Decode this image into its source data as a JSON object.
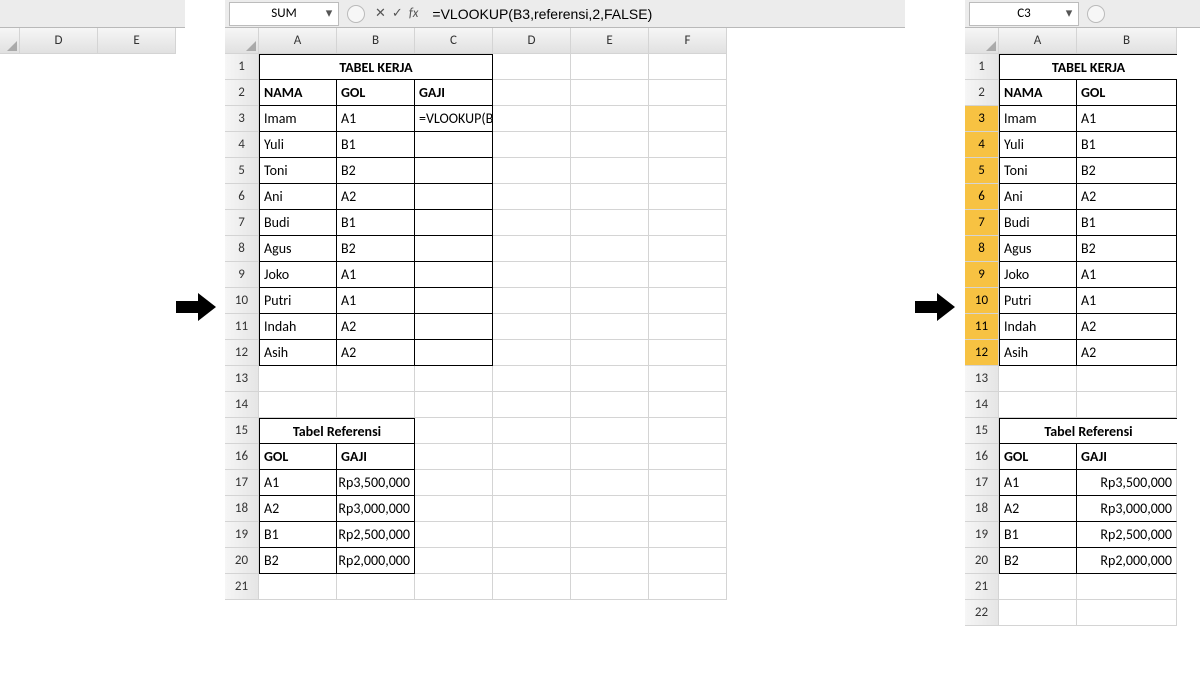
{
  "panel1": {
    "cols": [
      "D",
      "E"
    ]
  },
  "panel2": {
    "namebox": "SUM",
    "formula": "=VLOOKUP(B3,referensi,2,FALSE)",
    "cols": [
      "A",
      "B",
      "C",
      "D",
      "E",
      "F"
    ],
    "title": "TABEL KERJA",
    "headers": {
      "nama": "NAMA",
      "gol": "GOL",
      "gaji": "GAJI"
    },
    "rows": [
      {
        "r": "3",
        "nama": "Imam",
        "gol": "A1",
        "gaji": "=VLOOKUP(B3,referensi,2,FALSE)"
      },
      {
        "r": "4",
        "nama": "Yuli",
        "gol": "B1",
        "gaji": ""
      },
      {
        "r": "5",
        "nama": "Toni",
        "gol": "B2",
        "gaji": ""
      },
      {
        "r": "6",
        "nama": "Ani",
        "gol": "A2",
        "gaji": ""
      },
      {
        "r": "7",
        "nama": "Budi",
        "gol": "B1",
        "gaji": ""
      },
      {
        "r": "8",
        "nama": "Agus",
        "gol": "B2",
        "gaji": ""
      },
      {
        "r": "9",
        "nama": "Joko",
        "gol": "A1",
        "gaji": ""
      },
      {
        "r": "10",
        "nama": "Putri",
        "gol": "A1",
        "gaji": ""
      },
      {
        "r": "11",
        "nama": "Indah",
        "gol": "A2",
        "gaji": ""
      },
      {
        "r": "12",
        "nama": "Asih",
        "gol": "A2",
        "gaji": ""
      }
    ],
    "ref_title": "Tabel Referensi",
    "ref_headers": {
      "gol": "GOL",
      "gaji": "GAJI"
    },
    "ref_rows": [
      {
        "r": "17",
        "gol": "A1",
        "gaji": "Rp3,500,000"
      },
      {
        "r": "18",
        "gol": "A2",
        "gaji": "Rp3,000,000"
      },
      {
        "r": "19",
        "gol": "B1",
        "gaji": "Rp2,500,000"
      },
      {
        "r": "20",
        "gol": "B2",
        "gaji": "Rp2,000,000"
      }
    ],
    "empty_rows": [
      "13",
      "14"
    ],
    "row1": "1",
    "row2": "2",
    "row15": "15",
    "row16": "16",
    "row21": "21"
  },
  "panel3": {
    "namebox": "C3",
    "cols": [
      "A",
      "B"
    ],
    "title": "TABEL KERJA",
    "headers": {
      "nama": "NAMA",
      "gol": "GOL"
    },
    "rows": [
      {
        "r": "3",
        "nama": "Imam",
        "gol": "A1"
      },
      {
        "r": "4",
        "nama": "Yuli",
        "gol": "B1"
      },
      {
        "r": "5",
        "nama": "Toni",
        "gol": "B2"
      },
      {
        "r": "6",
        "nama": "Ani",
        "gol": "A2"
      },
      {
        "r": "7",
        "nama": "Budi",
        "gol": "B1"
      },
      {
        "r": "8",
        "nama": "Agus",
        "gol": "B2"
      },
      {
        "r": "9",
        "nama": "Joko",
        "gol": "A1"
      },
      {
        "r": "10",
        "nama": "Putri",
        "gol": "A1"
      },
      {
        "r": "11",
        "nama": "Indah",
        "gol": "A2"
      },
      {
        "r": "12",
        "nama": "Asih",
        "gol": "A2"
      }
    ],
    "ref_title": "Tabel Referensi",
    "ref_headers": {
      "gol": "GOL",
      "gaji": "GAJI"
    },
    "ref_rows": [
      {
        "r": "17",
        "gol": "A1",
        "gaji": "Rp3,500,000"
      },
      {
        "r": "18",
        "gol": "A2",
        "gaji": "Rp3,000,000"
      },
      {
        "r": "19",
        "gol": "B1",
        "gaji": "Rp2,500,000"
      },
      {
        "r": "20",
        "gol": "B2",
        "gaji": "Rp2,000,000"
      }
    ],
    "empty_rows": [
      "13",
      "14"
    ],
    "row1": "1",
    "row2": "2",
    "row15": "15",
    "row16": "16",
    "row21": "21",
    "row22": "22"
  },
  "icons": {
    "cancel": "✕",
    "confirm": "✓",
    "fx": "fx",
    "dd": "▾"
  }
}
